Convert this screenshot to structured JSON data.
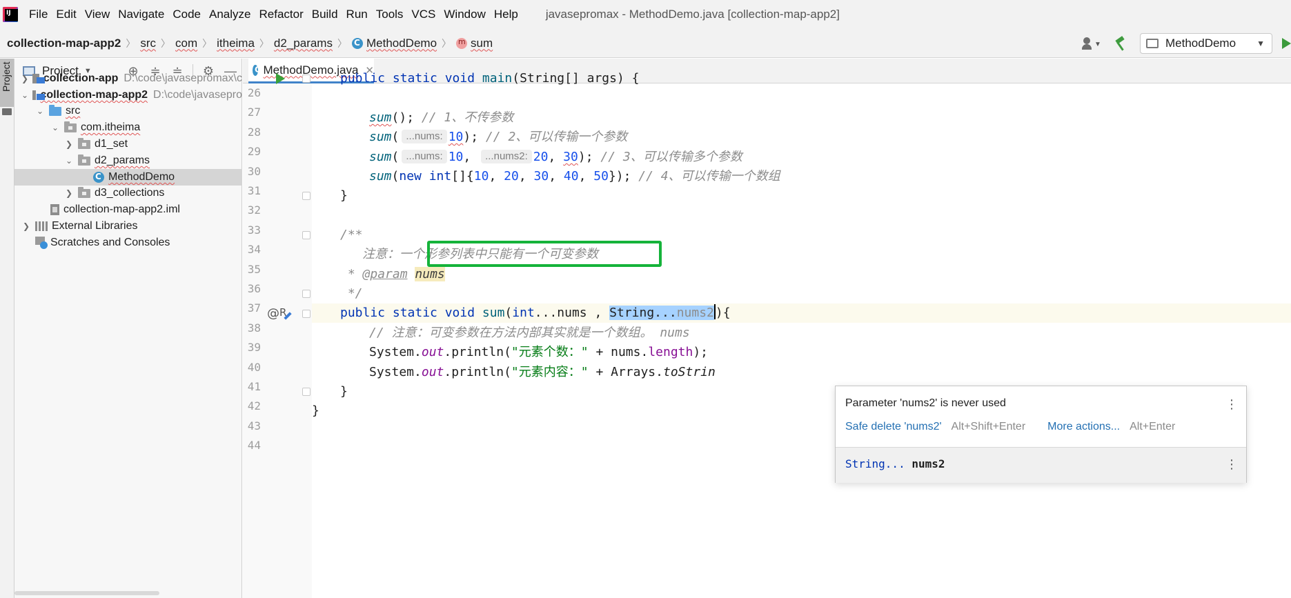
{
  "menubar": {
    "items": [
      "File",
      "Edit",
      "View",
      "Navigate",
      "Code",
      "Analyze",
      "Refactor",
      "Build",
      "Run",
      "Tools",
      "VCS",
      "Window",
      "Help"
    ],
    "window_title": "javasepromax - MethodDemo.java [collection-map-app2]"
  },
  "breadcrumb": {
    "items": [
      "collection-map-app2",
      "src",
      "com",
      "itheima",
      "d2_params",
      "MethodDemo",
      "sum"
    ]
  },
  "toolbar": {
    "run_config": "MethodDemo"
  },
  "tool_strip": {
    "project_tab": "Project"
  },
  "project_panel": {
    "title": "Project",
    "tree": [
      {
        "label": "collection-app",
        "path": "D:\\code\\javasepromax\\c"
      },
      {
        "label": "collection-map-app2",
        "path": "D:\\code\\javasepro"
      },
      {
        "label": "src"
      },
      {
        "label": "com.itheima"
      },
      {
        "label": "d1_set"
      },
      {
        "label": "d2_params"
      },
      {
        "label": "MethodDemo"
      },
      {
        "label": "d3_collections"
      },
      {
        "label": "collection-map-app2.iml"
      },
      {
        "label": "External Libraries"
      },
      {
        "label": "Scratches and Consoles"
      }
    ]
  },
  "editor": {
    "tab_label": "MethodDemo.java",
    "line_numbers": [
      "26",
      "27",
      "28",
      "29",
      "30",
      "31",
      "32",
      "33",
      "34",
      "35",
      "36",
      "37",
      "38",
      "39",
      "40",
      "41",
      "42",
      "43",
      "44"
    ],
    "code": {
      "l26": {
        "kw1": "public static void ",
        "fn": "main",
        "rest": "(String[] args) {"
      },
      "l28": {
        "call": "sum",
        "paren": "();",
        "comment": " // 1、不传参数"
      },
      "l29": {
        "call": "sum",
        "open": "(",
        "hint": "...nums:",
        "num": "10",
        "close": ");",
        "comment": " // 2、可以传输一个参数"
      },
      "l30": {
        "call": "sum",
        "open": "(",
        "hint1": "...nums:",
        "num1": "10",
        "comma": ", ",
        "hint2": "...nums2:",
        "num2": "20",
        "sep": ", ",
        "num3": "30",
        "close": ");",
        "comment": " // 3、可以传输多个参数"
      },
      "l31": {
        "call": "sum",
        "open": "(",
        "kw_new": "new ",
        "kw_int": "int",
        "arr": "[]{",
        "n1": "10",
        "n2": "20",
        "n3": "30",
        "n4": "40",
        "n5": "50",
        "sep": ", ",
        "close": "});",
        "comment": " // 4、可以传输一个数组"
      },
      "l32": "}",
      "l34": "/**",
      "l35": "注意：一个形参列表中只能有一个可变参数",
      "l36": {
        "star": " * ",
        "tag": "@param",
        "param": "nums"
      },
      "l37": " */",
      "l38": {
        "kw1": "public static void ",
        "fn": "sum",
        "open": "(",
        "kw_int": "int",
        "dots": "...nums , ",
        "sel_type": "String...",
        "sel_name": "nums2",
        "close": "){"
      },
      "l39": "// 注意：可变参数在方法内部其实就是一个数组。 nums",
      "l40": {
        "sys": "System.",
        "out": "out",
        "call": ".println(",
        "str": "\"元素个数：\"",
        "plus": " + nums.",
        "field": "length",
        "end": ");"
      },
      "l41": {
        "sys": "System.",
        "out": "out",
        "call": ".println(",
        "str": "\"元素内容：\"",
        "plus": " + Arrays.",
        "fn": "toStrin"
      },
      "l42": "}",
      "l43": "}"
    }
  },
  "popup": {
    "message": "Parameter 'nums2' is never used",
    "action1": "Safe delete 'nums2'",
    "action1_key": "Alt+Shift+Enter",
    "action2": "More actions...",
    "action2_key": "Alt+Enter",
    "sig_type": "String...",
    "sig_name": " nums2"
  },
  "colors": {
    "keyword": "#0033b3",
    "number": "#1750eb",
    "string": "#067d17",
    "comment": "#8c8c8c",
    "highlight_box": "#15b33a",
    "selection": "#a6d2ff"
  }
}
